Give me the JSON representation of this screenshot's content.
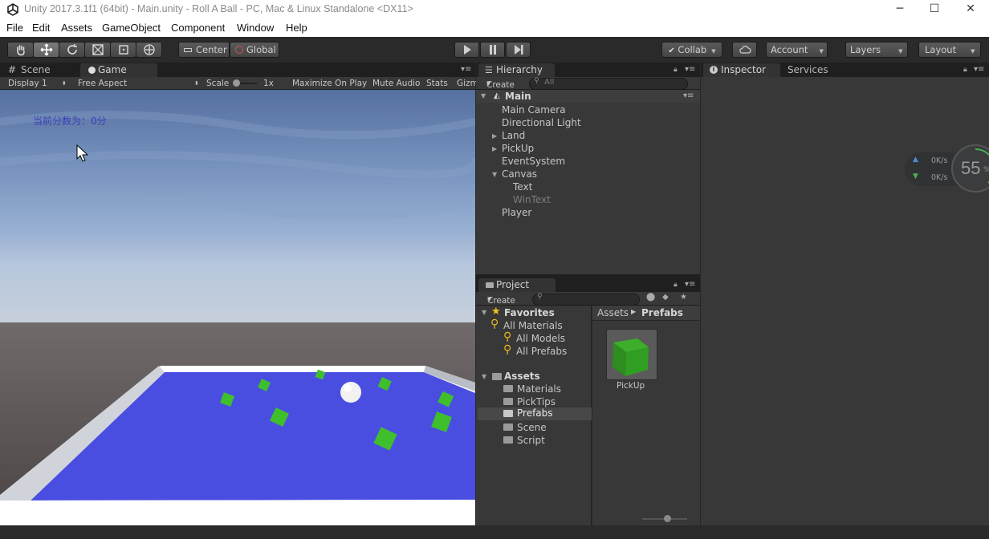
{
  "window": {
    "title": "Unity 2017.3.1f1 (64bit) - Main.unity - Roll A Ball - PC, Mac & Linux Standalone <DX11>",
    "minimize": "─",
    "maximize": "☐",
    "close": "✕"
  },
  "menu": [
    "File",
    "Edit",
    "Assets",
    "GameObject",
    "Component",
    "Window",
    "Help"
  ],
  "toolbar": {
    "pivot_mode": "Center",
    "pivot_rotation": "Global",
    "collab": "Collab",
    "account": "Account",
    "layers": "Layers",
    "layout": "Layout"
  },
  "scene_tab": "Scene",
  "game_tab": "Game",
  "game_bar": {
    "display": "Display 1",
    "aspect": "Free Aspect",
    "scale_label": "Scale",
    "scale_value": "1x",
    "maximize": "Maximize On Play",
    "mute": "Mute Audio",
    "stats": "Stats",
    "gizmos": "Gizm"
  },
  "game_view": {
    "score_text": "当前分数为：0分",
    "sky_top": "#5671a6",
    "ground_color": "#4a4ee0",
    "pickup_color": "#3fbf2c"
  },
  "hierarchy": {
    "tab": "Hierarchy",
    "create": "Create",
    "search_placeholder": "All",
    "scene_name": "Main",
    "items": [
      {
        "label": "Main Camera",
        "indent": 0,
        "expander": "",
        "dim": false
      },
      {
        "label": "Directional Light",
        "indent": 0,
        "expander": "",
        "dim": false
      },
      {
        "label": "Land",
        "indent": 0,
        "expander": "▶",
        "dim": false
      },
      {
        "label": "PickUp",
        "indent": 0,
        "expander": "▶",
        "dim": false
      },
      {
        "label": "EventSystem",
        "indent": 0,
        "expander": "",
        "dim": false
      },
      {
        "label": "Canvas",
        "indent": 0,
        "expander": "▼",
        "dim": false
      },
      {
        "label": "Text",
        "indent": 1,
        "expander": "",
        "dim": false
      },
      {
        "label": "WinText",
        "indent": 1,
        "expander": "",
        "dim": true
      },
      {
        "label": "Player",
        "indent": 0,
        "expander": "",
        "dim": false
      }
    ]
  },
  "project": {
    "tab": "Project",
    "create": "Create",
    "favorites_label": "Favorites",
    "favorites": [
      "All Materials",
      "All Models",
      "All Prefabs"
    ],
    "assets_label": "Assets",
    "folders": [
      "Materials",
      "PickTips",
      "Prefabs",
      "Scene",
      "Script"
    ],
    "selected_folder": "Prefabs",
    "breadcrumb_root": "Assets",
    "breadcrumb_current": "Prefabs",
    "asset_name": "PickUp"
  },
  "inspector": {
    "tab": "Inspector",
    "services_tab": "Services"
  },
  "net_widget": {
    "up": "0K/s",
    "down": "0K/s",
    "percent": "55",
    "percent_sign": "%"
  }
}
